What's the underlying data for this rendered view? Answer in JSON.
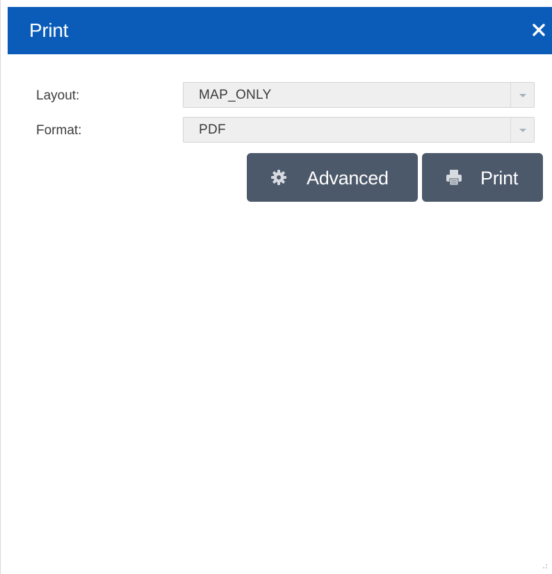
{
  "dialog": {
    "title": "Print",
    "close_icon": "close-icon"
  },
  "form": {
    "layout": {
      "label": "Layout:",
      "value": "MAP_ONLY"
    },
    "format": {
      "label": "Format:",
      "value": "PDF"
    }
  },
  "buttons": {
    "advanced": {
      "label": "Advanced",
      "icon": "gear-icon"
    },
    "print": {
      "label": "Print",
      "icon": "printer-icon"
    }
  },
  "colors": {
    "titlebar": "#0b5cb8",
    "button": "#4c596a"
  }
}
